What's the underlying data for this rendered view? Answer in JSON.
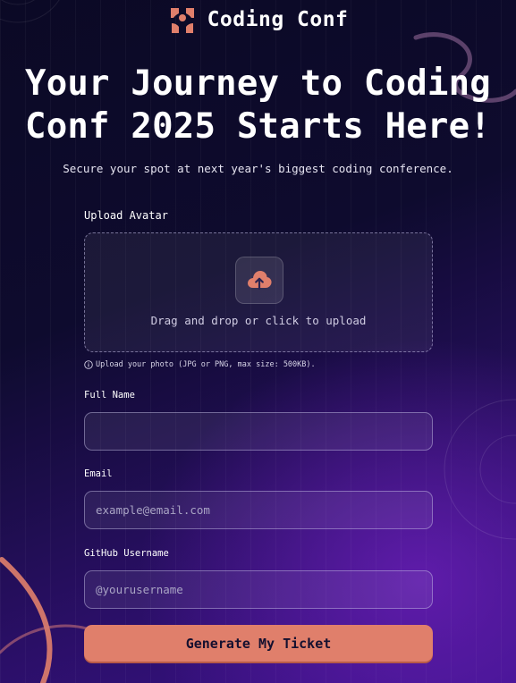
{
  "brand": {
    "name": "Coding Conf",
    "icon": "coding-conf-logo-icon",
    "accent": "#e07f6b"
  },
  "hero": {
    "title": "Your Journey to Coding Conf 2025 Starts Here!",
    "subtitle": "Secure your spot at next year's biggest coding conference."
  },
  "form": {
    "avatar": {
      "label": "Upload Avatar",
      "dropzone_text": "Drag and drop or click to upload",
      "icon": "cloud-upload-icon",
      "hint": "Upload your photo (JPG or PNG, max size: 500KB).",
      "hint_icon": "info-icon"
    },
    "full_name": {
      "label": "Full Name",
      "value": "",
      "placeholder": ""
    },
    "email": {
      "label": "Email",
      "value": "",
      "placeholder": "example@email.com"
    },
    "github": {
      "label": "GitHub Username",
      "value": "",
      "placeholder": "@yourusername"
    },
    "submit_label": "Generate My Ticket"
  },
  "colors": {
    "background_top": "#0b0925",
    "background_bottom": "#3a118a",
    "button": "#e07f6b",
    "button_text": "#15102f"
  }
}
